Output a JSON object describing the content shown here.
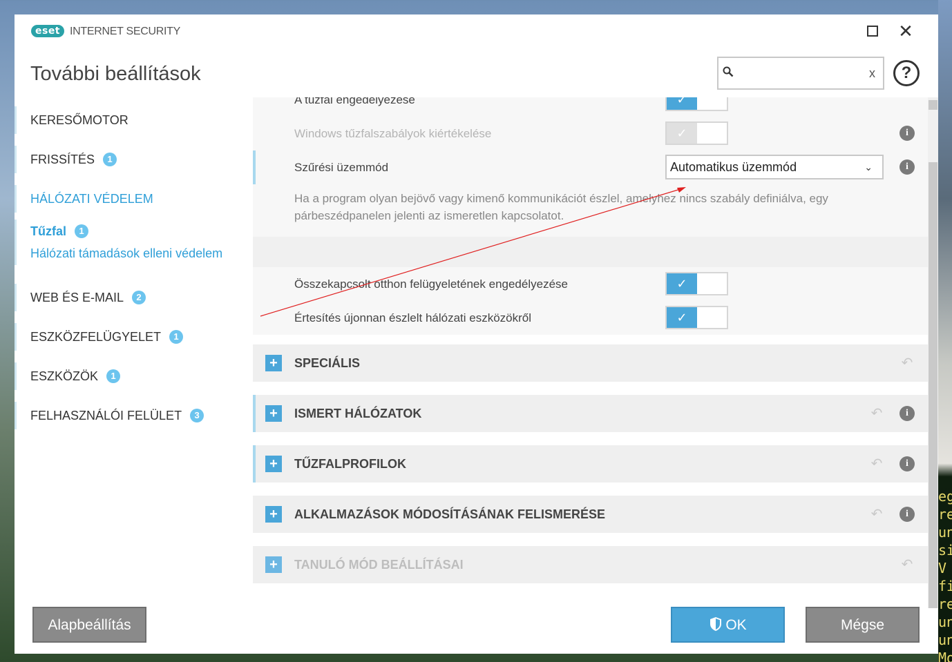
{
  "window": {
    "brand_logo": "eset",
    "product_name": "INTERNET SECURITY",
    "page_title": "További beállítások"
  },
  "search": {
    "value": "",
    "placeholder": "",
    "clear_label": "x"
  },
  "help": {
    "label": "?"
  },
  "sidebar": {
    "items": [
      {
        "label": "KERESŐMOTOR",
        "badge": ""
      },
      {
        "label": "FRISSÍTÉS",
        "badge": "1"
      },
      {
        "label": "HÁLÓZATI VÉDELEM",
        "badge": ""
      },
      {
        "label": "Tűzfal",
        "badge": "1"
      },
      {
        "label": "Hálózati támadások elleni védelem",
        "badge": ""
      },
      {
        "label": "WEB ÉS E-MAIL",
        "badge": "2"
      },
      {
        "label": "ESZKÖZFELÜGYELET",
        "badge": "1"
      },
      {
        "label": "ESZKÖZÖK",
        "badge": "1"
      },
      {
        "label": "FELHASZNÁLÓI FELÜLET",
        "badge": "3"
      }
    ]
  },
  "settings": {
    "partial_label": "A tűzfal engedélyezése",
    "windows_rules_label": "Windows tűzfalszabályok kiértékelése",
    "filter_mode_label": "Szűrési üzemmód",
    "filter_mode_value": "Automatikus üzemmód",
    "filter_mode_desc": "Ha a program olyan bejövő vagy kimenő kommunikációt észlel, amelyhez nincs szabály definiálva, egy párbeszédpanelen jelenti az ismeretlen kapcsolatot.",
    "home_monitor_label": "Összekapcsolt otthon felügyeletének engedélyezése",
    "new_devices_label": "Értesítés újonnan észlelt hálózati eszközökről",
    "toggle_check": "✓",
    "info_glyph": "i"
  },
  "sections": [
    {
      "title": "SPECIÁLIS"
    },
    {
      "title": "ISMERT HÁLÓZATOK"
    },
    {
      "title": "TŰZFALPROFILOK"
    },
    {
      "title": "ALKALMAZÁSOK MÓDOSÍTÁSÁNAK FELISMERÉSE"
    },
    {
      "title": "TANULÓ MÓD BEÁLLÍTÁSAI"
    }
  ],
  "footer": {
    "reset_label": "Alapbeállítás",
    "ok_label": "OK",
    "cancel_label": "Mégse"
  },
  "background_text": "eg\nres\nun\nsi\nV\nfin\nrec\nun\nun\nMod",
  "colors": {
    "accent": "#4aa6d9",
    "badge": "#6cc4ee",
    "arrow": "#e02020",
    "button_gray": "#8a8a8a"
  }
}
